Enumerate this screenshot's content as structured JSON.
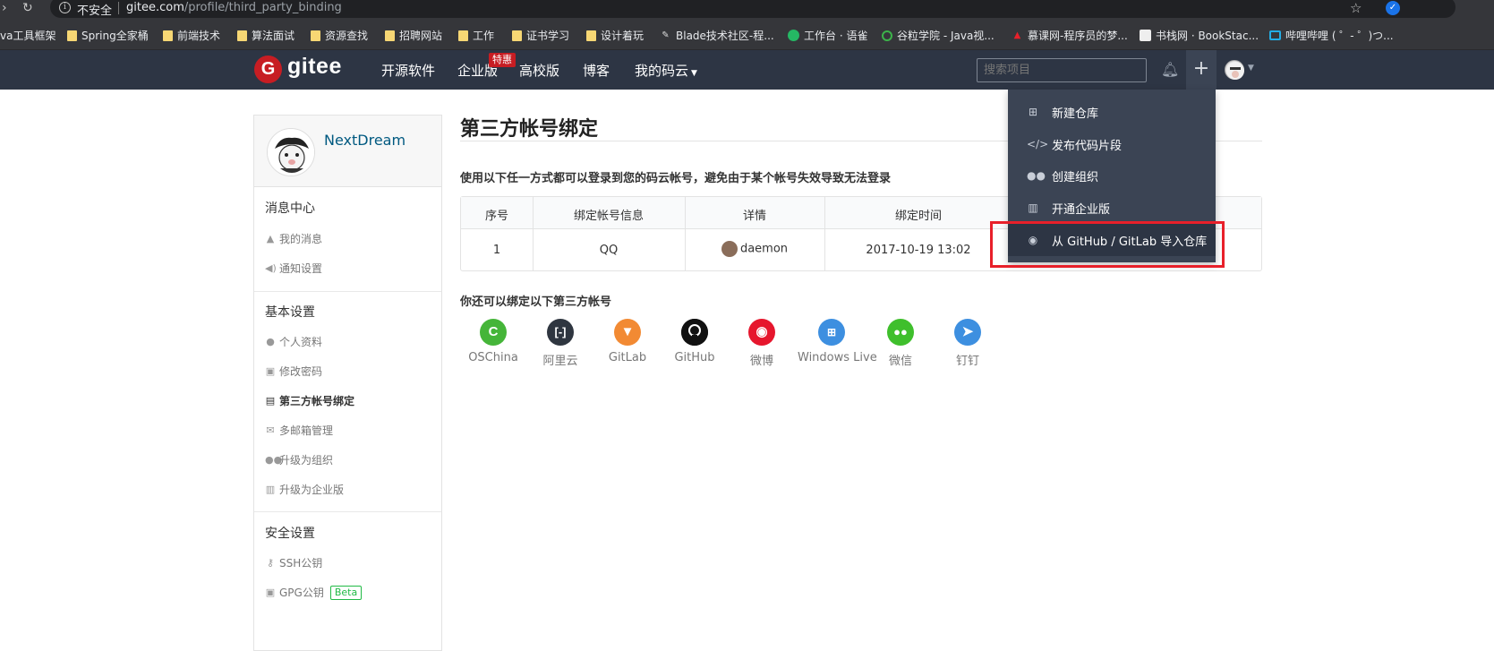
{
  "browser": {
    "insecure_label": "不安全",
    "url_host": "gitee.com",
    "url_path": "/profile/third_party_binding",
    "bookmarks": [
      {
        "label": "va工具框架",
        "icon": "none"
      },
      {
        "label": "Spring全家桶",
        "icon": "folder-icon"
      },
      {
        "label": "前端技术",
        "icon": "folder-icon"
      },
      {
        "label": "算法面试",
        "icon": "folder-icon"
      },
      {
        "label": "资源查找",
        "icon": "folder-icon"
      },
      {
        "label": "招聘网站",
        "icon": "folder-icon"
      },
      {
        "label": "工作",
        "icon": "folder-icon"
      },
      {
        "label": "证书学习",
        "icon": "folder-icon"
      },
      {
        "label": "设计着玩",
        "icon": "folder-icon"
      },
      {
        "label": "Blade技术社区-程...",
        "icon": "blade-icon"
      },
      {
        "label": "工作台 · 语雀",
        "icon": "yuque-icon"
      },
      {
        "label": "谷粒学院 - Java视...",
        "icon": "guli-icon"
      },
      {
        "label": "慕课网-程序员的梦...",
        "icon": "imooc-icon"
      },
      {
        "label": "书栈网 · BookStac...",
        "icon": "bookstack-icon"
      },
      {
        "label": "哔哩哔哩 ( ゜- ゜)つ...",
        "icon": "bilibili-icon"
      }
    ]
  },
  "nav": {
    "logo_text": "gitee",
    "items": [
      "开源软件",
      "企业版",
      "高校版",
      "博客",
      "我的码云"
    ],
    "hot_badge": "特惠",
    "search_placeholder": "搜索项目"
  },
  "sidebar": {
    "username": "NextDream",
    "sections": [
      {
        "title": "消息中心",
        "items": [
          {
            "label": "我的消息",
            "icon": "bell-icon",
            "active": false
          },
          {
            "label": "通知设置",
            "icon": "volume-icon",
            "active": false
          }
        ]
      },
      {
        "title": "基本设置",
        "items": [
          {
            "label": "个人资料",
            "icon": "user-icon",
            "active": false
          },
          {
            "label": "修改密码",
            "icon": "lock-icon",
            "active": false
          },
          {
            "label": "第三方帐号绑定",
            "icon": "address-card-icon",
            "active": true
          },
          {
            "label": "多邮箱管理",
            "icon": "mail-icon",
            "active": false
          },
          {
            "label": "升级为组织",
            "icon": "users-icon",
            "active": false
          },
          {
            "label": "升级为企业版",
            "icon": "building-icon",
            "active": false
          }
        ]
      },
      {
        "title": "安全设置",
        "items": [
          {
            "label": "SSH公钥",
            "icon": "key-icon",
            "active": false
          },
          {
            "label": "GPG公钥",
            "icon": "lock-icon",
            "active": false,
            "badge": "Beta"
          }
        ]
      }
    ]
  },
  "main": {
    "title": "第三方帐号绑定",
    "intro": "使用以下任一方式都可以登录到您的码云帐号，避免由于某个帐号失效导致无法登录",
    "table": {
      "headers": [
        "序号",
        "绑定帐号信息",
        "详情",
        "绑定时间"
      ],
      "rows": [
        {
          "index": "1",
          "account": "QQ",
          "detail": "daemon",
          "time": "2017-10-19 13:02"
        }
      ]
    },
    "more_title": "你还可以绑定以下第三方帐号",
    "providers": [
      {
        "label": "OSChina",
        "icon": "oschina-icon",
        "color": "#45b539"
      },
      {
        "label": "阿里云",
        "icon": "aliyun-icon",
        "color": "#2f3640"
      },
      {
        "label": "GitLab",
        "icon": "gitlab-icon",
        "color": "#f28a33"
      },
      {
        "label": "GitHub",
        "icon": "github-icon",
        "color": "#111111"
      },
      {
        "label": "微博",
        "icon": "weibo-icon",
        "color": "#e6162d"
      },
      {
        "label": "Windows Live",
        "icon": "windows-icon",
        "color": "#3d8fe0"
      },
      {
        "label": "微信",
        "icon": "wechat-icon",
        "color": "#3fbf2c"
      },
      {
        "label": "钉钉",
        "icon": "dingtalk-icon",
        "color": "#3d8fe0"
      }
    ]
  },
  "dropdown": {
    "items": [
      {
        "label": "新建仓库",
        "icon": "plus-square-icon"
      },
      {
        "label": "发布代码片段",
        "icon": "code-icon"
      },
      {
        "label": "创建组织",
        "icon": "users-icon"
      },
      {
        "label": "开通企业版",
        "icon": "building-icon"
      },
      {
        "label": "从 GitHub / GitLab 导入仓库",
        "icon": "github-icon"
      }
    ]
  },
  "colors": {
    "nav_bg": "#2d3544",
    "dropdown_bg": "#3b4454",
    "brand_red": "#c71d23",
    "highlight_border": "#e8202a",
    "link_blue": "#005980"
  }
}
